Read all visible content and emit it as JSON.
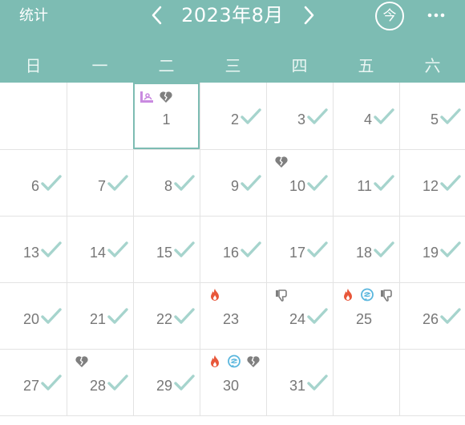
{
  "header": {
    "stats_label": "统计",
    "month_title": "2023年8月",
    "today_label": "今",
    "background_color": "#7dbcb3"
  },
  "weekdays": [
    "日",
    "一",
    "二",
    "三",
    "四",
    "五",
    "六"
  ],
  "colors": {
    "check": "#a6d4cd",
    "fire": "#e8573a",
    "chat": "#5bb7de",
    "heart": "#7f7f7f",
    "thumb": "#7f7f7f",
    "mood": "#c98ae0"
  },
  "days": [
    {
      "day": "1",
      "checked": false,
      "selected": true,
      "marks": [
        "mood-icon",
        "broken-heart-icon"
      ]
    },
    {
      "day": "2",
      "checked": true,
      "marks": []
    },
    {
      "day": "3",
      "checked": true,
      "marks": []
    },
    {
      "day": "4",
      "checked": true,
      "marks": []
    },
    {
      "day": "5",
      "checked": true,
      "marks": []
    },
    {
      "day": "6",
      "checked": true,
      "marks": []
    },
    {
      "day": "7",
      "checked": true,
      "marks": []
    },
    {
      "day": "8",
      "checked": true,
      "marks": []
    },
    {
      "day": "9",
      "checked": true,
      "marks": []
    },
    {
      "day": "10",
      "checked": true,
      "marks": [
        "broken-heart-icon"
      ]
    },
    {
      "day": "11",
      "checked": true,
      "marks": []
    },
    {
      "day": "12",
      "checked": true,
      "marks": []
    },
    {
      "day": "13",
      "checked": true,
      "marks": []
    },
    {
      "day": "14",
      "checked": true,
      "marks": []
    },
    {
      "day": "15",
      "checked": true,
      "marks": []
    },
    {
      "day": "16",
      "checked": true,
      "marks": []
    },
    {
      "day": "17",
      "checked": true,
      "marks": []
    },
    {
      "day": "18",
      "checked": true,
      "marks": []
    },
    {
      "day": "19",
      "checked": true,
      "marks": []
    },
    {
      "day": "20",
      "checked": true,
      "marks": []
    },
    {
      "day": "21",
      "checked": true,
      "marks": []
    },
    {
      "day": "22",
      "checked": true,
      "marks": []
    },
    {
      "day": "23",
      "checked": false,
      "marks": [
        "fire-icon"
      ]
    },
    {
      "day": "24",
      "checked": true,
      "marks": [
        "thumbs-down-icon"
      ]
    },
    {
      "day": "25",
      "checked": false,
      "marks": [
        "fire-icon",
        "chat-bubble-icon",
        "thumbs-down-icon"
      ]
    },
    {
      "day": "26",
      "checked": true,
      "marks": []
    },
    {
      "day": "27",
      "checked": true,
      "marks": []
    },
    {
      "day": "28",
      "checked": true,
      "marks": [
        "broken-heart-icon"
      ]
    },
    {
      "day": "29",
      "checked": true,
      "marks": []
    },
    {
      "day": "30",
      "checked": false,
      "marks": [
        "fire-icon",
        "chat-bubble-icon",
        "broken-heart-icon"
      ]
    },
    {
      "day": "31",
      "checked": true,
      "marks": []
    }
  ]
}
